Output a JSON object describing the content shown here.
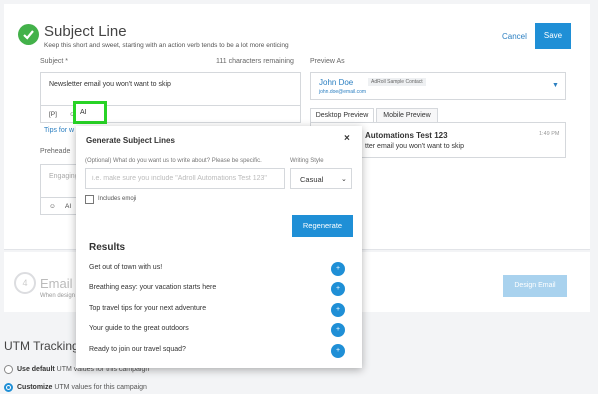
{
  "section": {
    "title": "Subject Line",
    "subtitle": "Keep this short and sweet, starting with an action verb tends to be a lot more enticing",
    "cancel_label": "Cancel",
    "save_label": "Save"
  },
  "subject": {
    "label": "Subject *",
    "chars_remaining": "111 characters remaining",
    "value": "Newsletter email you won't want to skip",
    "toolbar": [
      "[P]",
      "☺",
      "AI"
    ],
    "tips_link": "Tips for w"
  },
  "preheader": {
    "label": "Preheade",
    "placeholder": "Engaging",
    "toolbar": [
      "☺",
      "AI"
    ]
  },
  "preview": {
    "label": "Preview As",
    "contact_name": "John Doe",
    "contact_badge": "AdRoll Sample Contact",
    "contact_email": "john.doe@email.com",
    "tabs": [
      "Desktop Preview",
      "Mobile Preview"
    ],
    "inbox_title": "Automations Test 123",
    "inbox_line": "tter email you won't want to skip",
    "inbox_time": "1:49 PM"
  },
  "step4": {
    "number": "4",
    "title": "Email C",
    "subtitle": "When design",
    "button_label": "Design Email"
  },
  "utm": {
    "title": "UTM Tracking",
    "options": [
      {
        "bold": "Use default",
        "rest": " UTM values for this campaign",
        "selected": false
      },
      {
        "bold": "Customize",
        "rest": " UTM values for this campaign",
        "selected": true
      }
    ]
  },
  "modal": {
    "title": "Generate Subject Lines",
    "close": "×",
    "prompt_label": "(Optional) What do you want us to write about? Please be specific.",
    "prompt_placeholder": "i.e. make sure you include \"Adroll Automations Test 123\"",
    "style_label": "Writing Style",
    "style_value": "Casual",
    "emoji_label": "Includes emoji",
    "regenerate_label": "Regenerate",
    "results_title": "Results",
    "results": [
      "Get out of town with us!",
      "Breathing easy: your vacation starts here",
      "Top travel tips for your next adventure",
      "Your guide to the great outdoors",
      "Ready to join our travel squad?"
    ],
    "add_symbol": "+"
  },
  "colors": {
    "accent": "#1f8fd6",
    "success": "#43b14a",
    "highlight": "#28d326"
  }
}
